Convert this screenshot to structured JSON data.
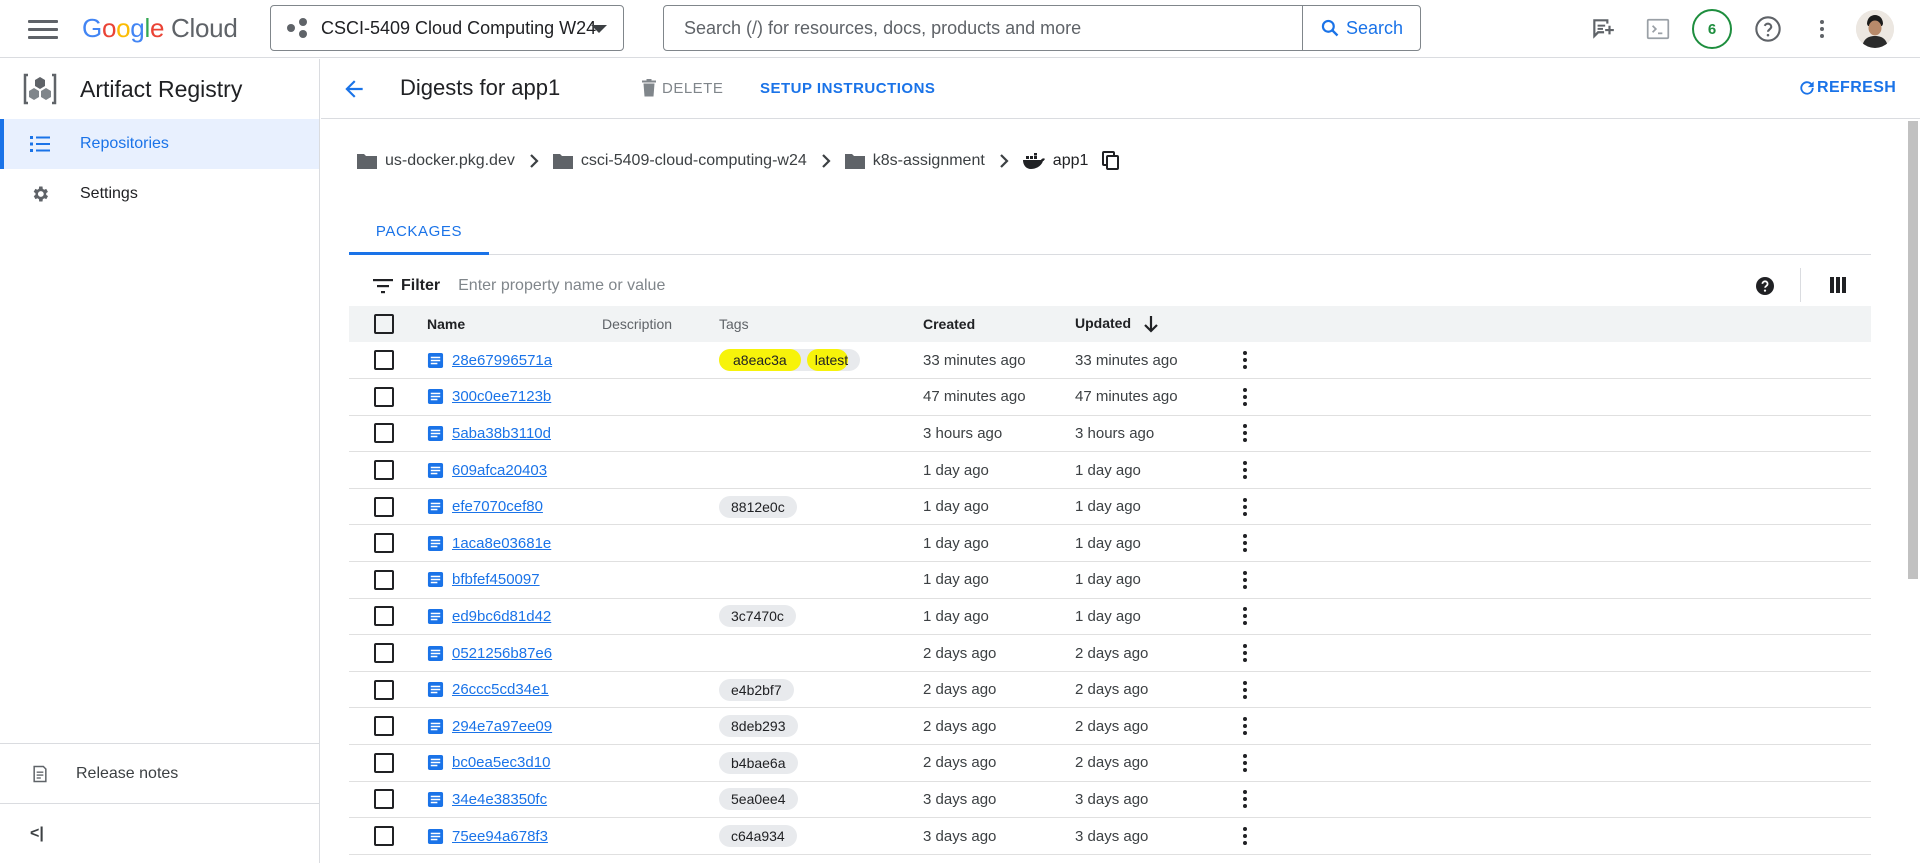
{
  "header": {
    "logo_parts": [
      "G",
      "o",
      "o",
      "g",
      "l",
      "e"
    ],
    "logo_cloud": "Cloud",
    "project_name": "CSCI-5409 Cloud Computing W24",
    "search_placeholder": "Search (/) for resources, docs, products and more",
    "search_button": "Search",
    "notification_count": "6"
  },
  "sidebar": {
    "product_title": "Artifact Registry",
    "items": [
      {
        "label": "Repositories",
        "icon": "list-icon",
        "active": true
      },
      {
        "label": "Settings",
        "icon": "gear-icon",
        "active": false
      }
    ],
    "release_notes": "Release notes",
    "collapse_label": "<|"
  },
  "actionbar": {
    "title": "Digests for app1",
    "delete_label": "DELETE",
    "setup_label": "SETUP INSTRUCTIONS",
    "refresh_label": "REFRESH"
  },
  "breadcrumb": [
    "us-docker.pkg.dev",
    "csci-5409-cloud-computing-w24",
    "k8s-assignment",
    "app1"
  ],
  "tabs": [
    {
      "label": "PACKAGES"
    }
  ],
  "filter": {
    "label": "Filter",
    "placeholder": "Enter property name or value"
  },
  "table": {
    "columns": {
      "name": "Name",
      "description": "Description",
      "tags": "Tags",
      "created": "Created",
      "updated": "Updated"
    },
    "rows": [
      {
        "name": "28e67996571a",
        "tags": [
          "a8eac3a",
          "latest"
        ],
        "created": "33 minutes ago",
        "updated": "33 minutes ago"
      },
      {
        "name": "300c0ee7123b",
        "tags": [],
        "created": "47 minutes ago",
        "updated": "47 minutes ago"
      },
      {
        "name": "5aba38b3110d",
        "tags": [],
        "created": "3 hours ago",
        "updated": "3 hours ago"
      },
      {
        "name": "609afca20403",
        "tags": [],
        "created": "1 day ago",
        "updated": "1 day ago"
      },
      {
        "name": "efe7070cef80",
        "tags": [
          "8812e0c"
        ],
        "created": "1 day ago",
        "updated": "1 day ago"
      },
      {
        "name": "1aca8e03681e",
        "tags": [],
        "created": "1 day ago",
        "updated": "1 day ago"
      },
      {
        "name": "bfbfef450097",
        "tags": [],
        "created": "1 day ago",
        "updated": "1 day ago"
      },
      {
        "name": "ed9bc6d81d42",
        "tags": [
          "3c7470c"
        ],
        "created": "1 day ago",
        "updated": "1 day ago"
      },
      {
        "name": "0521256b87e6",
        "tags": [],
        "created": "2 days ago",
        "updated": "2 days ago"
      },
      {
        "name": "26ccc5cd34e1",
        "tags": [
          "e4b2bf7"
        ],
        "created": "2 days ago",
        "updated": "2 days ago"
      },
      {
        "name": "294e7a97ee09",
        "tags": [
          "8deb293"
        ],
        "created": "2 days ago",
        "updated": "2 days ago"
      },
      {
        "name": "bc0ea5ec3d10",
        "tags": [
          "b4bae6a"
        ],
        "created": "2 days ago",
        "updated": "2 days ago"
      },
      {
        "name": "34e4e38350fc",
        "tags": [
          "5ea0ee4"
        ],
        "created": "3 days ago",
        "updated": "3 days ago"
      },
      {
        "name": "75ee94a678f3",
        "tags": [
          "c64a934"
        ],
        "created": "3 days ago",
        "updated": "3 days ago"
      }
    ]
  },
  "colors": {
    "accent": "#1a73e8",
    "highlight": "#f7f30a",
    "badge_green": "#1e8e3e"
  }
}
